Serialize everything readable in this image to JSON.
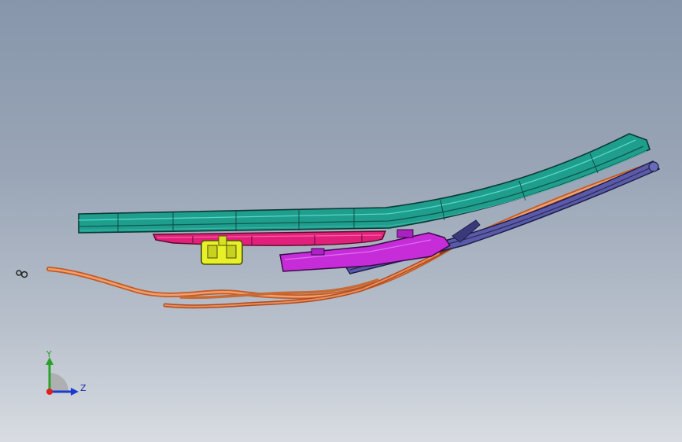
{
  "viewport": {
    "background_top": "#8796ab",
    "background_bottom": "#d8dce2"
  },
  "model": {
    "parts": [
      {
        "name": "teal-rail",
        "color": "#1f9e8e"
      },
      {
        "name": "magenta-channel",
        "color": "#e0207a"
      },
      {
        "name": "yellow-bracket",
        "color": "#e8f028"
      },
      {
        "name": "purple-track",
        "color": "#c22ed8"
      },
      {
        "name": "blue-guide",
        "color": "#4a4a9a"
      },
      {
        "name": "orange-cable",
        "color": "#e07a3c"
      },
      {
        "name": "small-clip",
        "color": "#333333"
      }
    ]
  },
  "triad": {
    "y_label": "Y",
    "z_label": "Z",
    "y_color": "#2aa22a",
    "z_color": "#1a3ad0",
    "origin_color": "#e02020"
  }
}
